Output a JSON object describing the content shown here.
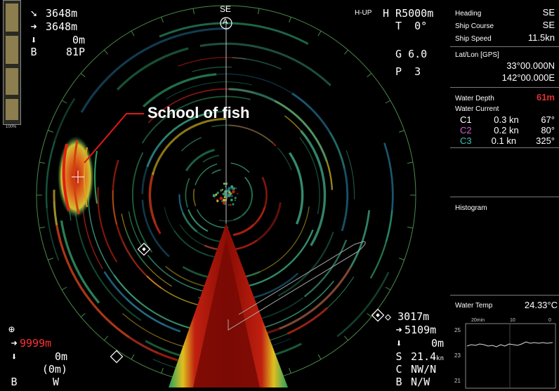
{
  "top_left": {
    "range_a": "3648m",
    "range_b": "3648m",
    "range_c": "0m",
    "b_label": "B",
    "b_value": "81P",
    "depth_scale_label": "100%"
  },
  "top_center": {
    "bearing": "SE",
    "marker": "A"
  },
  "top_right_params": {
    "mode": "H-UP",
    "range_label": "H R5000m",
    "tilt_label": "T",
    "tilt_value": "0°",
    "gain_label": "G",
    "gain_value": "6.0",
    "p_label": "P",
    "p_value": "3"
  },
  "annotation": {
    "text": "School of fish",
    "line_color": "#e01818"
  },
  "bottom_left": {
    "range_a": "9999m",
    "range_b": "0m",
    "range_c": "(0m)",
    "b_label": "B",
    "b_value": "W"
  },
  "bottom_right": {
    "range_a": "3017m",
    "range_b": "5109m",
    "range_c": "0m",
    "s_label": "S",
    "s_value": "21.4",
    "s_unit": "kn",
    "c_label": "C",
    "c_value": "NW/N",
    "b_label": "B",
    "b_value": "N/W"
  },
  "panel": {
    "heading_label": "Heading",
    "heading_value": "SE",
    "course_label": "Ship Course",
    "course_value": "SE",
    "speed_label": "Ship Speed",
    "speed_value": "11.5kn",
    "latlon_label": "Lat/Lon [GPS]",
    "lat": "33°00.000N",
    "lon": "142°00.000E",
    "depth_label": "Water Depth",
    "depth_value": "61m",
    "current_label": "Water Current",
    "currents": [
      {
        "id": "C1",
        "speed": "0.3 kn",
        "dir": "67°",
        "color": "#ffffff"
      },
      {
        "id": "C2",
        "speed": "0.2 kn",
        "dir": "80°",
        "color": "#d060d0"
      },
      {
        "id": "C3",
        "speed": "0.1 kn",
        "dir": "325°",
        "color": "#40c0b0"
      }
    ],
    "histogram_label": "Histogram",
    "temp_label": "Water Temp",
    "temp_value": "24.33°C",
    "temp_chart": {
      "x_ticks": [
        "20min",
        "10",
        "0"
      ],
      "y_ticks": [
        "25",
        "23",
        "21"
      ]
    }
  },
  "colors": {
    "background": "#000000",
    "ring": "#4a8a4a",
    "echo_red": "#b81808",
    "echo_yellow": "#e0c020",
    "echo_green": "#30a060",
    "depth_red": "#e03030",
    "alert_red": "#ff3030"
  }
}
